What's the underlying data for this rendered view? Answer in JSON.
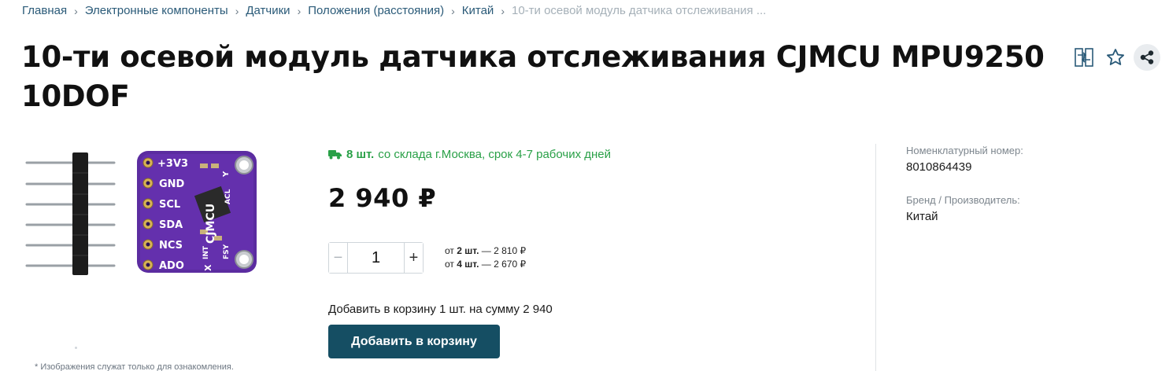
{
  "breadcrumb": {
    "items": [
      "Главная",
      "Электронные компоненты",
      "Датчики",
      "Положения (расстояния)",
      "Китай"
    ],
    "current": "10-ти осевой модуль датчика отслеживания ...",
    "separator": "›"
  },
  "product": {
    "title": "10-ти осевой модуль датчика отслеживания CJMCU MPU9250 10DOF",
    "board_labels": [
      "+3V3",
      "GND",
      "SCL",
      "SDA",
      "NCS",
      "ADO"
    ],
    "board_side_labels": [
      "CJMCU",
      "Y",
      "ACL",
      "INT",
      "X",
      "FSY"
    ],
    "disclaimer": "* Изображения служат только для ознакомления."
  },
  "stock": {
    "count": "8 шт.",
    "text": "со склада г.Москва, срок 4-7 рабочих дней",
    "icon": "truck-icon",
    "color": "#29a047"
  },
  "price": "2 940 ₽",
  "quantity": {
    "value": "1",
    "minus": "−",
    "plus": "+"
  },
  "tiers": [
    {
      "prefix": "от",
      "qty": "2 шт.",
      "price": "— 2 810 ₽"
    },
    {
      "prefix": "от",
      "qty": "4 шт.",
      "price": "— 2 670 ₽"
    }
  ],
  "cart": {
    "summary": "Добавить в корзину 1 шт. на сумму 2 940",
    "button": "Добавить в корзину",
    "color": "#154e63"
  },
  "meta": {
    "sku_label": "Номенклатурный номер:",
    "sku_value": "8010864439",
    "brand_label": "Бренд / Производитель:",
    "brand_value": "Китай"
  },
  "actions": [
    "compare-icon",
    "star-icon",
    "share-icon"
  ]
}
